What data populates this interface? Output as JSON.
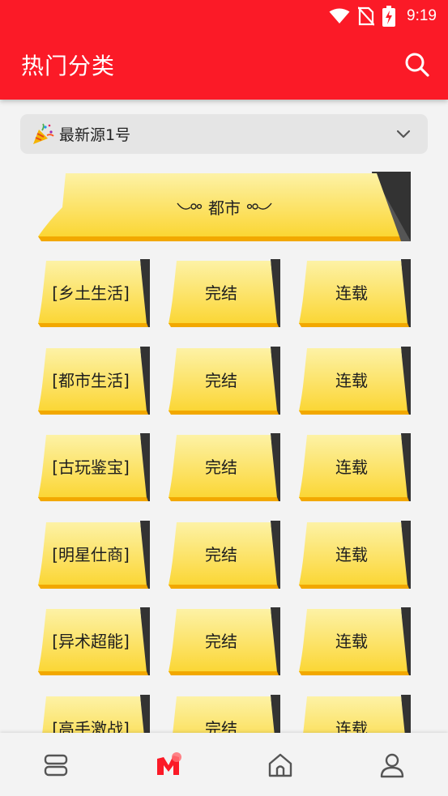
{
  "status_bar": {
    "time": "9:19",
    "icons": [
      "wifi-icon",
      "no-sim-icon",
      "battery-charging-icon"
    ]
  },
  "app_bar": {
    "title": "热门分类",
    "search_icon": "search-icon",
    "color": "#fb1a27"
  },
  "source_selector": {
    "icon": "party-popper-icon",
    "label": "最新源1号",
    "chevron_icon": "chevron-down-icon"
  },
  "banner": {
    "label": "都市"
  },
  "categories": [
    [
      "[乡土生活]",
      "完结",
      "连载"
    ],
    [
      "[都市生活]",
      "完结",
      "连载"
    ],
    [
      "[古玩鉴宝]",
      "完结",
      "连载"
    ],
    [
      "[明星仕商]",
      "完结",
      "连载"
    ],
    [
      "[异术超能]",
      "完结",
      "连载"
    ],
    [
      "[高手激战]",
      "完结",
      "连载"
    ]
  ],
  "bottom_nav": {
    "items": [
      "bookshelf-icon",
      "category-icon",
      "home-icon",
      "profile-icon"
    ],
    "active": "category-icon",
    "active_color": "#fb1a27"
  }
}
